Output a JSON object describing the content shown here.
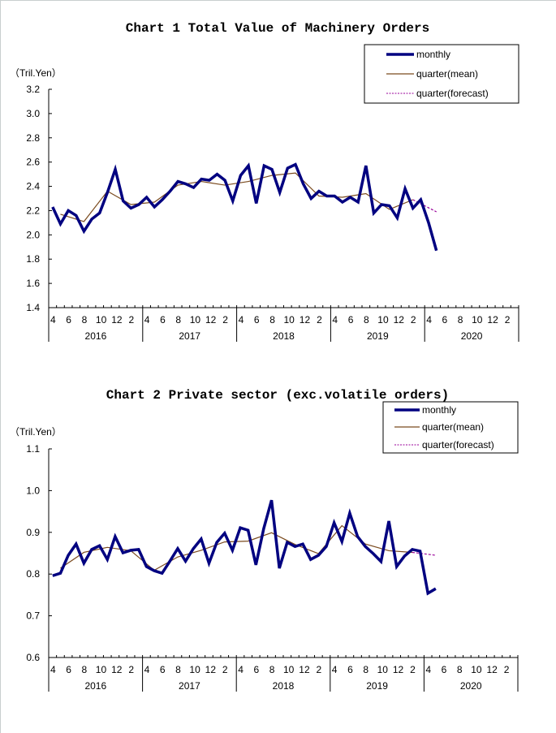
{
  "chart_data": [
    {
      "type": "line",
      "title": "Chart 1 Total Value of Machinery Orders",
      "ylabel": "（Tril.Yen）",
      "xlabel": "",
      "ylim": [
        1.4,
        3.2
      ],
      "yticks": [
        "1.4",
        "1.6",
        "1.8",
        "2.0",
        "2.2",
        "2.4",
        "2.6",
        "2.8",
        "3.0",
        "3.2"
      ],
      "month_ticks": [
        "4",
        "6",
        "8",
        "10",
        "12",
        "2"
      ],
      "years": [
        "2016",
        "2017",
        "2018",
        "2019",
        "2020"
      ],
      "legend": {
        "placement": "top-right",
        "entries": [
          "monthly",
          "quarter(mean)",
          "quarter(forecast)"
        ]
      },
      "colors": {
        "monthly": "#000080",
        "mean": "#7a4a1e",
        "forecast": "#990099"
      },
      "series": [
        {
          "name": "monthly",
          "start": "2016-04",
          "values": [
            2.23,
            2.09,
            2.2,
            2.16,
            2.03,
            2.13,
            2.18,
            2.35,
            2.54,
            2.28,
            2.22,
            2.25,
            2.31,
            2.23,
            2.29,
            2.36,
            2.44,
            2.42,
            2.39,
            2.46,
            2.45,
            2.5,
            2.45,
            2.28,
            2.49,
            2.57,
            2.26,
            2.57,
            2.54,
            2.35,
            2.55,
            2.58,
            2.42,
            2.3,
            2.36,
            2.32,
            2.32,
            2.27,
            2.31,
            2.27,
            2.57,
            2.18,
            2.25,
            2.24,
            2.14,
            2.38,
            2.22,
            2.29,
            2.1,
            1.87
          ]
        },
        {
          "name": "quarter(mean)",
          "month_index": [
            1,
            4,
            7,
            10,
            13,
            16,
            19,
            22,
            25,
            28,
            31,
            34,
            37,
            40,
            43,
            46
          ],
          "values": [
            2.17,
            2.11,
            2.36,
            2.25,
            2.27,
            2.41,
            2.44,
            2.41,
            2.44,
            2.49,
            2.51,
            2.32,
            2.31,
            2.34,
            2.21,
            2.29
          ]
        },
        {
          "name": "quarter(forecast)",
          "month_index": [
            46,
            49
          ],
          "values": [
            2.29,
            2.19
          ]
        }
      ]
    },
    {
      "type": "line",
      "title": "Chart 2 Private sector (exc.volatile orders)",
      "ylabel": "（Tril.Yen）",
      "xlabel": "",
      "ylim": [
        0.6,
        1.1
      ],
      "yticks": [
        "0.6",
        "0.7",
        "0.8",
        "0.9",
        "1.0",
        "1.1"
      ],
      "month_ticks": [
        "4",
        "6",
        "8",
        "10",
        "12",
        "2"
      ],
      "years": [
        "2016",
        "2017",
        "2018",
        "2019",
        "2020"
      ],
      "legend": {
        "placement": "top-right",
        "entries": [
          "monthly",
          "quarter(mean)",
          "quarter(forecast)"
        ]
      },
      "colors": {
        "monthly": "#000080",
        "mean": "#7a4a1e",
        "forecast": "#990099"
      },
      "series": [
        {
          "name": "monthly",
          "start": "2016-04",
          "values": [
            0.796,
            0.802,
            0.845,
            0.872,
            0.826,
            0.859,
            0.868,
            0.835,
            0.89,
            0.851,
            0.857,
            0.859,
            0.818,
            0.808,
            0.802,
            0.831,
            0.861,
            0.831,
            0.861,
            0.884,
            0.826,
            0.876,
            0.898,
            0.857,
            0.911,
            0.905,
            0.822,
            0.909,
            0.977,
            0.814,
            0.876,
            0.866,
            0.872,
            0.835,
            0.845,
            0.866,
            0.923,
            0.878,
            0.946,
            0.89,
            0.866,
            0.849,
            0.83,
            0.927,
            0.818,
            0.843,
            0.859,
            0.855,
            0.754,
            0.765
          ]
        },
        {
          "name": "quarter(mean)",
          "month_index": [
            1,
            4,
            7,
            10,
            13,
            16,
            19,
            22,
            25,
            28,
            31,
            34,
            37,
            40,
            43,
            46
          ],
          "values": [
            0.814,
            0.852,
            0.864,
            0.856,
            0.809,
            0.841,
            0.857,
            0.877,
            0.879,
            0.899,
            0.871,
            0.849,
            0.916,
            0.872,
            0.856,
            0.852
          ]
        },
        {
          "name": "quarter(forecast)",
          "month_index": [
            46,
            49
          ],
          "values": [
            0.852,
            0.845
          ]
        }
      ]
    }
  ]
}
